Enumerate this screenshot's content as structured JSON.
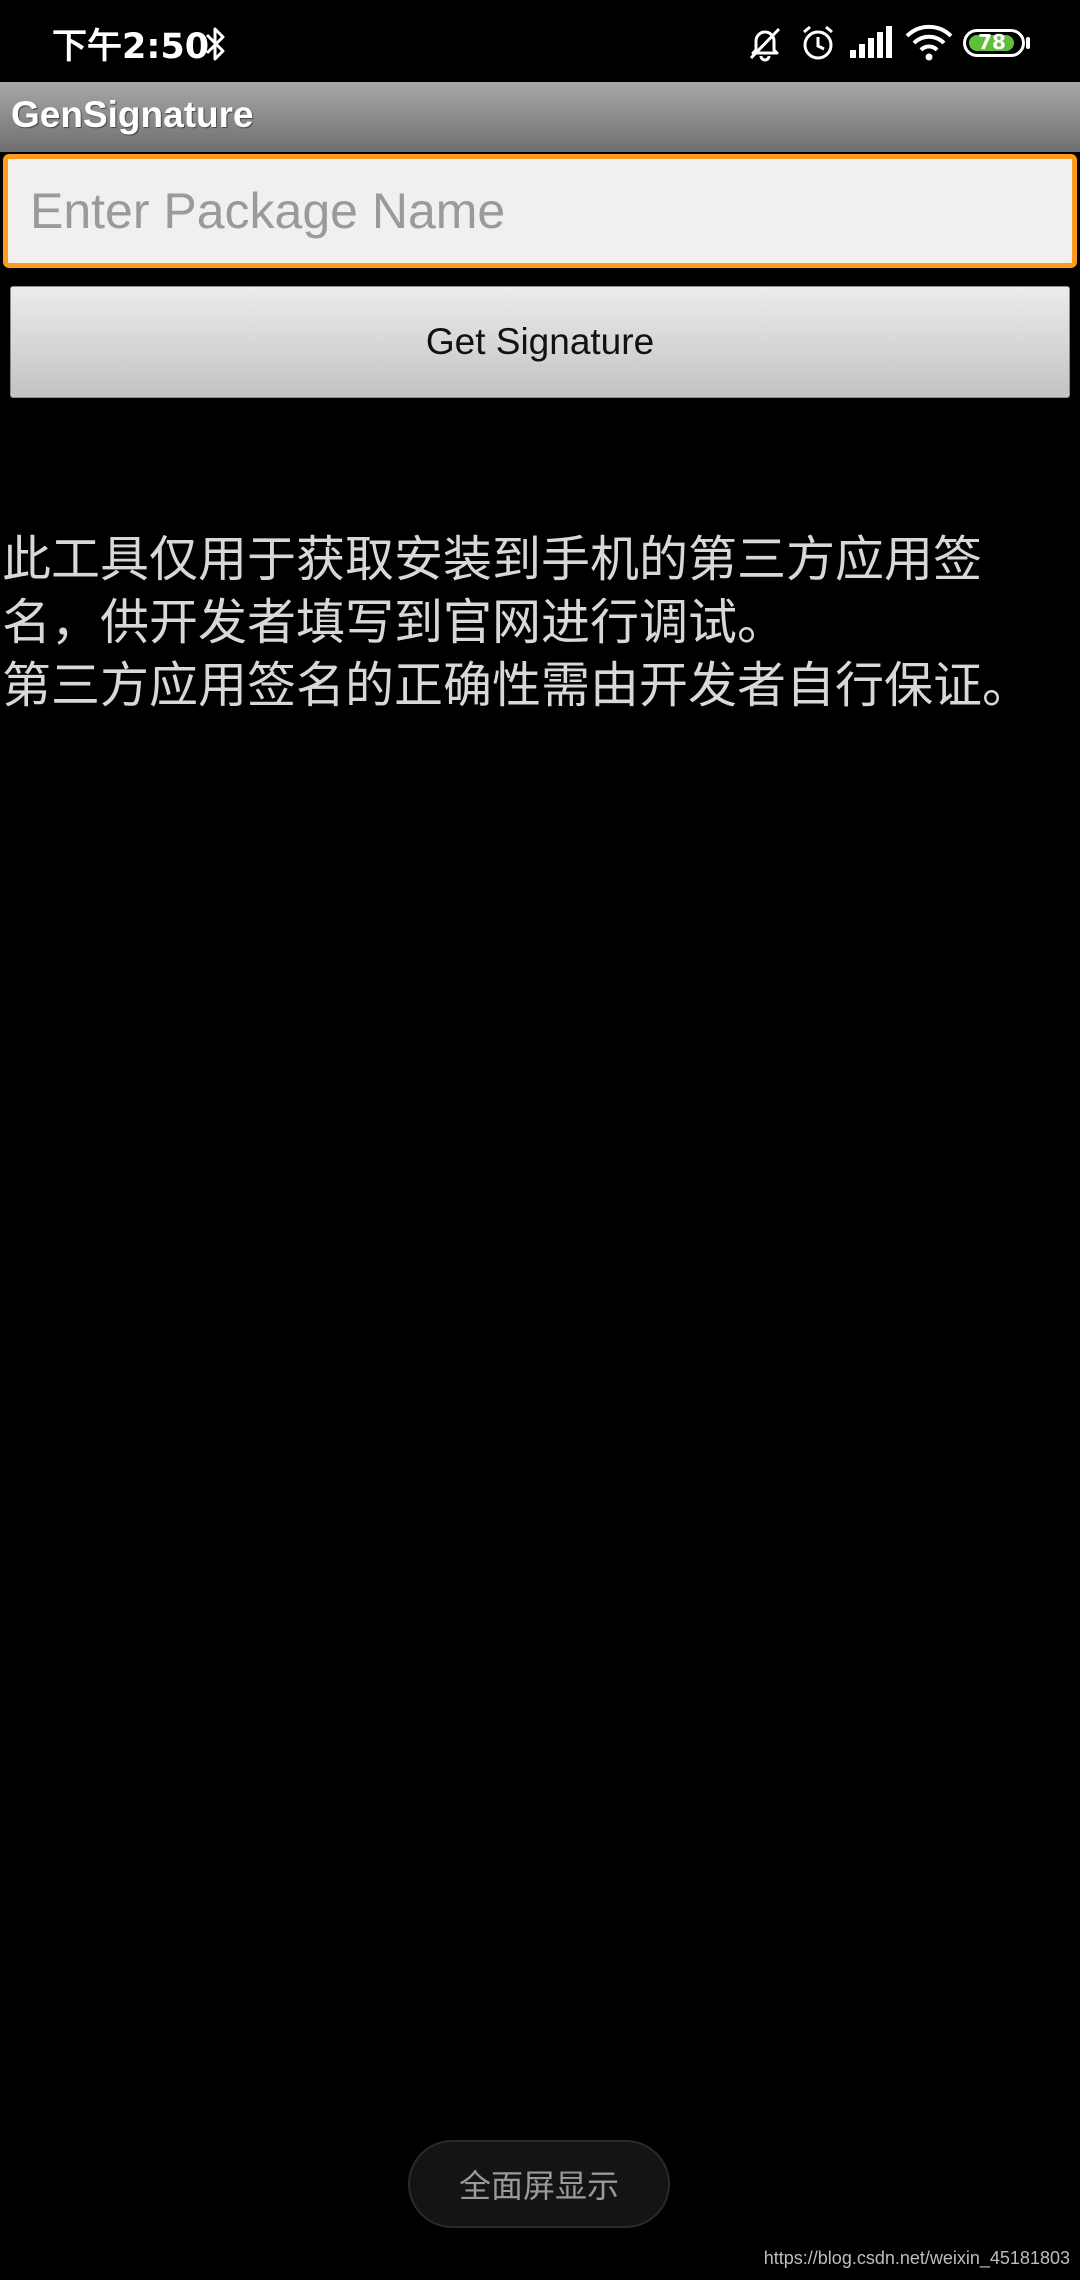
{
  "status_bar": {
    "time": "下午2:50",
    "battery_level": "78",
    "battery_color": "#5fbf3a",
    "icons": [
      "bluetooth-icon",
      "mute-icon",
      "alarm-icon",
      "signal-icon",
      "wifi-icon",
      "battery-icon"
    ]
  },
  "app": {
    "title": "GenSignature"
  },
  "form": {
    "package_placeholder": "Enter Package Name",
    "package_value": "",
    "button_label": "Get Signature",
    "accent_color": "#ff9a1f"
  },
  "description": {
    "text": "此工具仅用于获取安装到手机的第三方应用签名，供开发者填写到官网进行调试。\n第三方应用签名的正确性需由开发者自行保证。"
  },
  "system": {
    "fullscreen_label": "全面屏显示"
  },
  "watermark": {
    "text": "https://blog.csdn.net/weixin_45181803"
  }
}
